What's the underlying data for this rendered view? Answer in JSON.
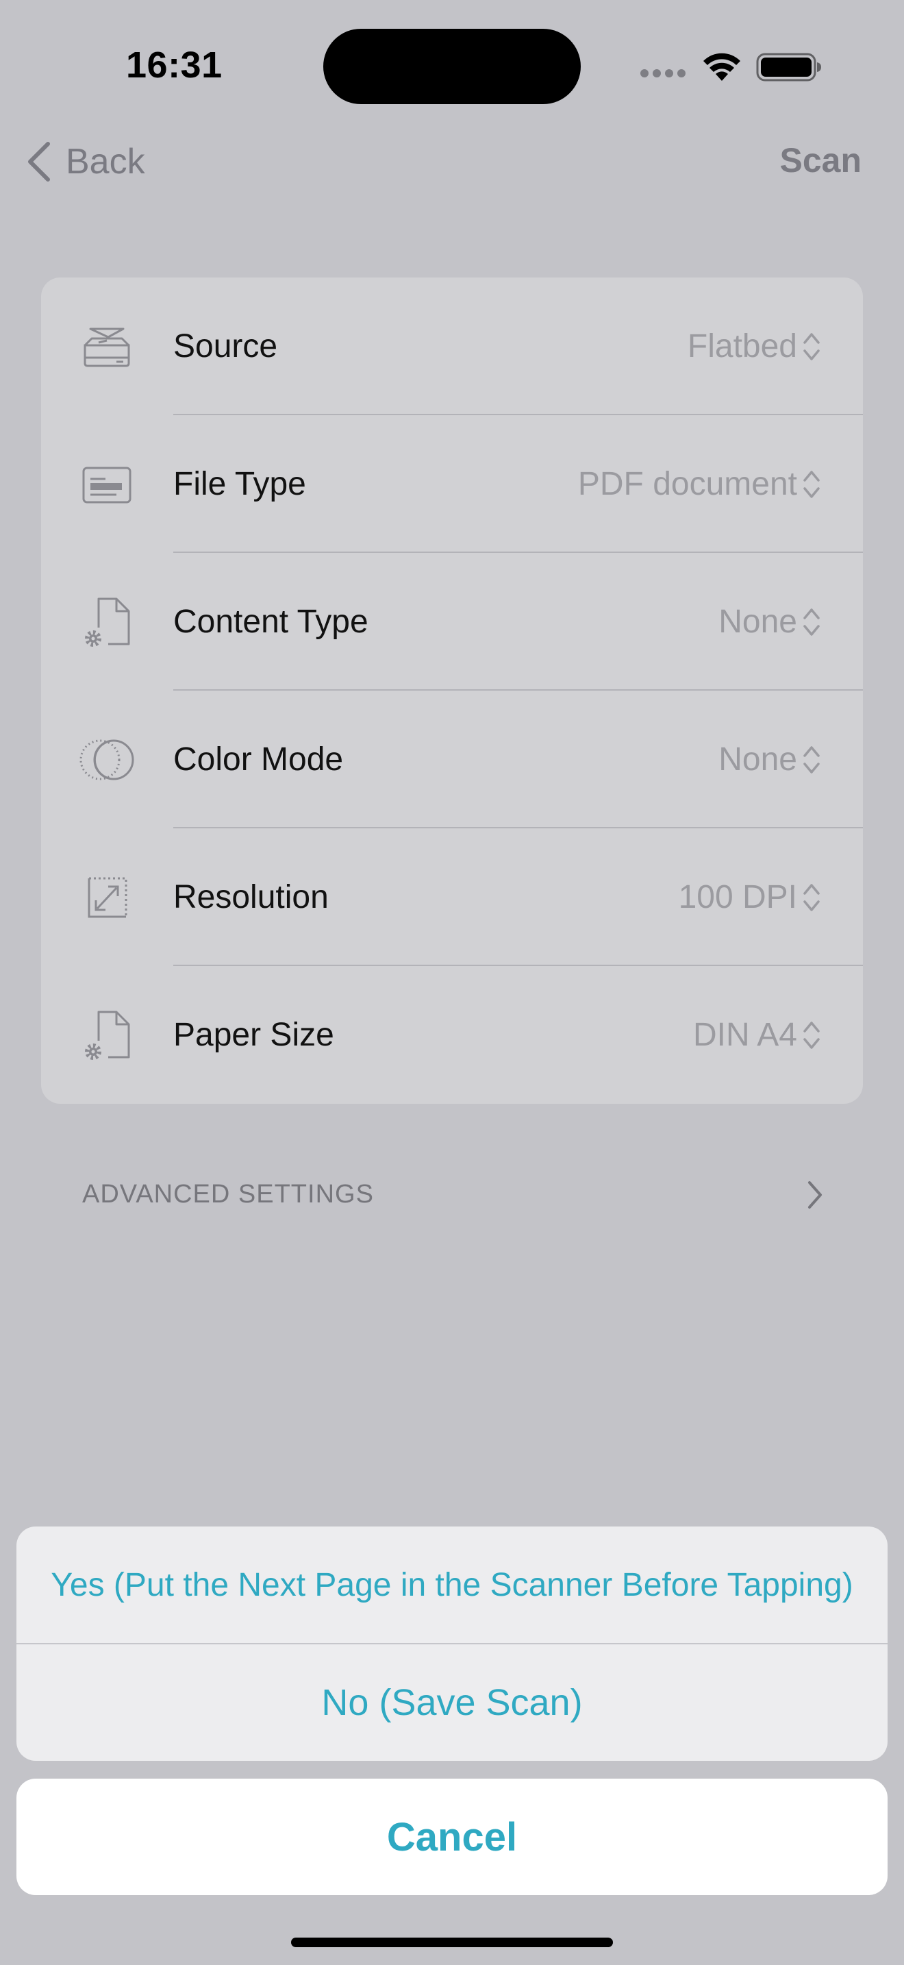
{
  "status_bar": {
    "time": "16:31"
  },
  "nav": {
    "back_label": "Back",
    "scan_label": "Scan"
  },
  "settings": [
    {
      "label": "Source",
      "value": "Flatbed",
      "icon": "scanner-icon"
    },
    {
      "label": "File Type",
      "value": "PDF document",
      "icon": "file-type-icon"
    },
    {
      "label": "Content Type",
      "value": "None",
      "icon": "document-gear-icon"
    },
    {
      "label": "Color Mode",
      "value": "None",
      "icon": "color-mode-icon"
    },
    {
      "label": "Resolution",
      "value": "100 DPI",
      "icon": "resize-arrow-icon"
    },
    {
      "label": "Paper Size",
      "value": "DIN A4",
      "icon": "document-gear-icon"
    }
  ],
  "advanced": {
    "label": "ADVANCED SETTINGS"
  },
  "action_sheet": {
    "yes_label": "Yes (Put the Next Page in the Scanner Before Tapping)",
    "no_label": "No (Save Scan)",
    "cancel_label": "Cancel"
  },
  "colors": {
    "accent": "#2fa9c2",
    "dimmed_background": "#c3c3c8",
    "card": "#d1d1d4"
  }
}
